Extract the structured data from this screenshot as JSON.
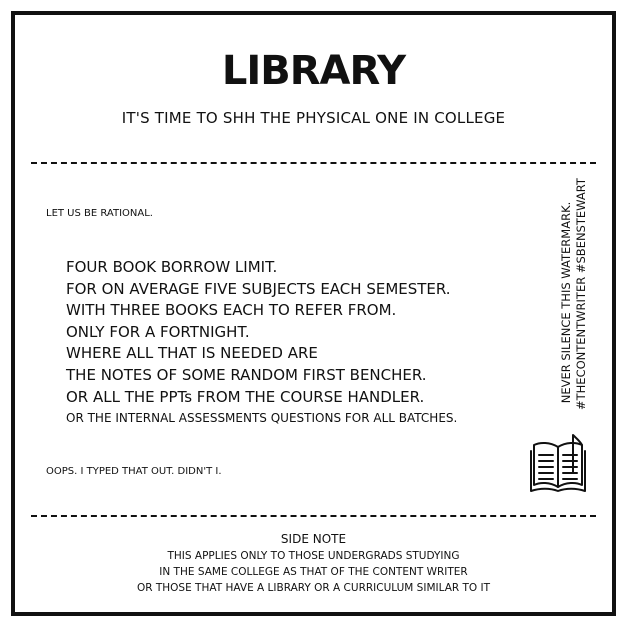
{
  "header": {
    "title": "LIBRARY",
    "subtitle": "IT'S TIME TO SHH THE PHYSICAL ONE IN COLLEGE"
  },
  "body": {
    "intro": "LET US BE RATIONAL.",
    "lines": [
      "FOUR BOOK BORROW LIMIT.",
      "FOR ON AVERAGE FIVE SUBJECTS EACH SEMESTER.",
      "WITH THREE BOOKS EACH TO REFER FROM.",
      "ONLY FOR A FORTNIGHT.",
      "WHERE ALL THAT IS NEEDED ARE",
      "THE NOTES OF SOME RANDOM FIRST BENCHER.",
      "OR ALL THE PPTs FROM THE COURSE HANDLER.",
      "OR THE INTERNAL ASSESSMENTS QUESTIONS FOR ALL BATCHES."
    ],
    "outro": "OOPS. I TYPED THAT OUT. DIDN'T I."
  },
  "watermark": {
    "line1": "NEVER SILENCE THIS WATERMARK.",
    "line2": "#THECONTENTWRITER #SBENSTEWART"
  },
  "icon": "open-book-icon",
  "side_note": {
    "title": "SIDE NOTE",
    "lines": [
      "THIS APPLIES ONLY TO THOSE UNDERGRADS STUDYING",
      "IN THE SAME COLLEGE AS THAT OF THE CONTENT WRITER",
      "OR THOSE THAT HAVE A LIBRARY OR A CURRICULUM SIMILAR TO IT"
    ]
  },
  "colors": {
    "ink": "#111111",
    "background": "#ffffff"
  }
}
